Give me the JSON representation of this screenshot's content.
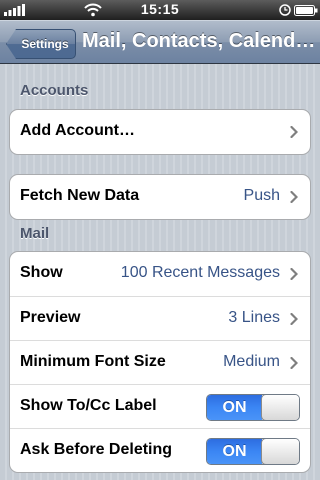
{
  "status_bar": {
    "time": "15:15"
  },
  "nav": {
    "back_label": "Settings",
    "title": "Mail, Contacts, Calend…"
  },
  "sections": {
    "accounts_header": "Accounts",
    "mail_header": "Mail"
  },
  "accounts": {
    "add_account_label": "Add Account…"
  },
  "fetch": {
    "label": "Fetch New Data",
    "value": "Push"
  },
  "mail": {
    "show_label": "Show",
    "show_value": "100 Recent Messages",
    "preview_label": "Preview",
    "preview_value": "3 Lines",
    "font_size_label": "Minimum Font Size",
    "font_size_value": "Medium",
    "tocc_label": "Show To/Cc Label",
    "tocc_toggle": "ON",
    "ask_delete_label": "Ask Before Deleting",
    "ask_delete_toggle": "ON"
  },
  "colors": {
    "accent_value_text": "#385487",
    "toggle_on": "#3b86f4",
    "background": "#c5ccd4"
  }
}
